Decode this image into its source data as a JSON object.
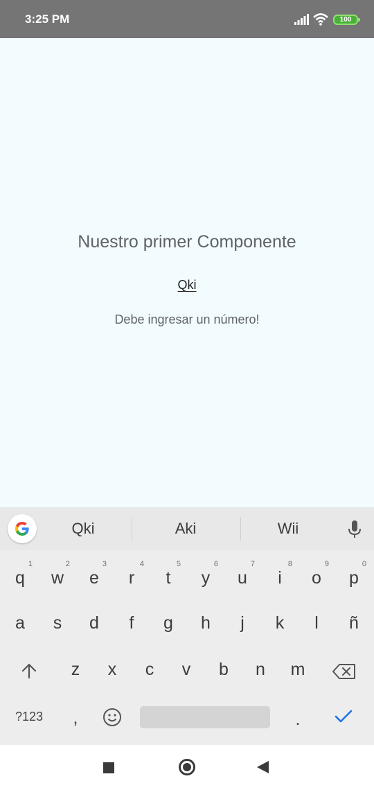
{
  "status_bar": {
    "time": "3:25 PM",
    "battery": "100"
  },
  "main": {
    "title": "Nuestro primer Componente",
    "input_value": "Qki",
    "error": "Debe ingresar un número!"
  },
  "keyboard": {
    "suggestions": [
      "Qki",
      "Aki",
      "Wii"
    ],
    "row1": [
      {
        "key": "q",
        "hint": "1"
      },
      {
        "key": "w",
        "hint": "2"
      },
      {
        "key": "e",
        "hint": "3"
      },
      {
        "key": "r",
        "hint": "4"
      },
      {
        "key": "t",
        "hint": "5"
      },
      {
        "key": "y",
        "hint": "6"
      },
      {
        "key": "u",
        "hint": "7"
      },
      {
        "key": "i",
        "hint": "8"
      },
      {
        "key": "o",
        "hint": "9"
      },
      {
        "key": "p",
        "hint": "0"
      }
    ],
    "row2": [
      "a",
      "s",
      "d",
      "f",
      "g",
      "h",
      "j",
      "k",
      "l",
      "ñ"
    ],
    "row3": [
      "z",
      "x",
      "c",
      "v",
      "b",
      "n",
      "m"
    ],
    "symbols_label": "?123",
    "comma": ",",
    "period": "."
  },
  "colors": {
    "accent": "#1a73e8",
    "status_bar": "#757575",
    "background": "#f2fbfe"
  },
  "icons": [
    "signal-icon",
    "wifi-icon",
    "battery-icon",
    "google-icon",
    "mic-icon",
    "shift-icon",
    "backspace-icon",
    "emoji-icon",
    "check-icon"
  ]
}
